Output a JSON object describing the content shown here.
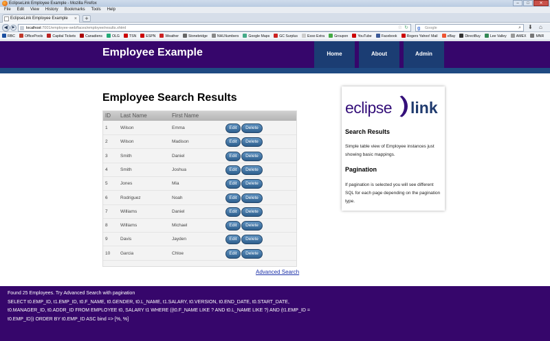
{
  "browser": {
    "window_title": "EclipseLink Employee Example - Mozilla Firefox",
    "window_controls": [
      "–",
      "□",
      "✕"
    ],
    "menu": [
      "File",
      "Edit",
      "View",
      "History",
      "Bookmarks",
      "Tools",
      "Help"
    ],
    "tab_title": "EclipseLink Employee Example",
    "new_tab": "+",
    "url_host": "localhost",
    "url_path": ":7001/employee-web/faces/employee/results.xhtml",
    "search_placeholder": "Google",
    "bookmarks": [
      {
        "label": "RBC",
        "color": "#1b4fa0"
      },
      {
        "label": "OfficePools",
        "color": "#c0392b"
      },
      {
        "label": "Capital Tickets",
        "color": "#b22"
      },
      {
        "label": "Canadiens",
        "color": "#a00"
      },
      {
        "label": "OLG",
        "color": "#2a7"
      },
      {
        "label": "TSN",
        "color": "#c00"
      },
      {
        "label": "ESPN",
        "color": "#c00"
      },
      {
        "label": "Weather",
        "color": "#c22"
      },
      {
        "label": "Stonebridge",
        "color": "#666"
      },
      {
        "label": "NHLNumbers",
        "color": "#888"
      },
      {
        "label": "Google Maps",
        "color": "#4a8"
      },
      {
        "label": "GC Surplus",
        "color": "#c22"
      },
      {
        "label": "Esso Extra",
        "color": "#ccc"
      },
      {
        "label": "Groupon",
        "color": "#4a4"
      },
      {
        "label": "YouTube",
        "color": "#c00"
      },
      {
        "label": "Facebook",
        "color": "#3b5998"
      },
      {
        "label": "Rogers Yahoo! Mail",
        "color": "#c00"
      },
      {
        "label": "eBay",
        "color": "#e53"
      },
      {
        "label": "DirectBuy",
        "color": "#333"
      },
      {
        "label": "Lee Valley",
        "color": "#385"
      },
      {
        "label": "AMEX",
        "color": "#999"
      },
      {
        "label": "MNR",
        "color": "#777"
      }
    ]
  },
  "header": {
    "title": "Employee Example",
    "nav": [
      "Home",
      "About",
      "Admin"
    ]
  },
  "main": {
    "heading": "Employee Search Results",
    "columns": [
      "ID",
      "Last Name",
      "First Name"
    ],
    "rows": [
      {
        "id": "1",
        "last": "Wilson",
        "first": "Emma"
      },
      {
        "id": "2",
        "last": "Wilson",
        "first": "Madison"
      },
      {
        "id": "3",
        "last": "Smith",
        "first": "Daniel"
      },
      {
        "id": "4",
        "last": "Smith",
        "first": "Joshua"
      },
      {
        "id": "5",
        "last": "Jones",
        "first": "Mia"
      },
      {
        "id": "6",
        "last": "Rodriguez",
        "first": "Noah"
      },
      {
        "id": "7",
        "last": "Williams",
        "first": "Daniel"
      },
      {
        "id": "8",
        "last": "Williams",
        "first": "Michael"
      },
      {
        "id": "9",
        "last": "Davis",
        "first": "Jayden"
      },
      {
        "id": "10",
        "last": "Garcia",
        "first": "Chloe"
      }
    ],
    "edit_label": "Edit",
    "delete_label": "Delete",
    "advanced_search": "Advanced Search"
  },
  "sidebar": {
    "logo_left": "eclipse",
    "logo_right": "link",
    "results_heading": "Search Results",
    "results_text": "Simple table view of Employee instances just showing basic mappings.",
    "pagination_heading": "Pagination",
    "pagination_text": "If pagination is selected you will see different SQL for each page depending on the pagination type."
  },
  "footer": {
    "line1": "Found 25 Employees. Try Advanced Search with pagination",
    "line2": "SELECT t0.EMP_ID, t1.EMP_ID, t0.F_NAME, t0.GENDER, t0.L_NAME, t1.SALARY, t0.VERSION, t0.END_DATE, t0.START_DATE,",
    "line3": "t0.MANAGER_ID, t0.ADDR_ID FROM EMPLOYEE t0, SALARY t1 WHERE ((t0.F_NAME LIKE ? AND t0.L_NAME LIKE ?) AND (t1.EMP_ID =",
    "line4": "t0.EMP_ID)) ORDER BY t0.EMP_ID ASC bind => [%, %]"
  },
  "colors": {
    "header_purple": "#36066b",
    "stripe_blue": "#1f4a82",
    "nav_tab": "#1b3d73",
    "button_blue": "#2e5f8e"
  }
}
